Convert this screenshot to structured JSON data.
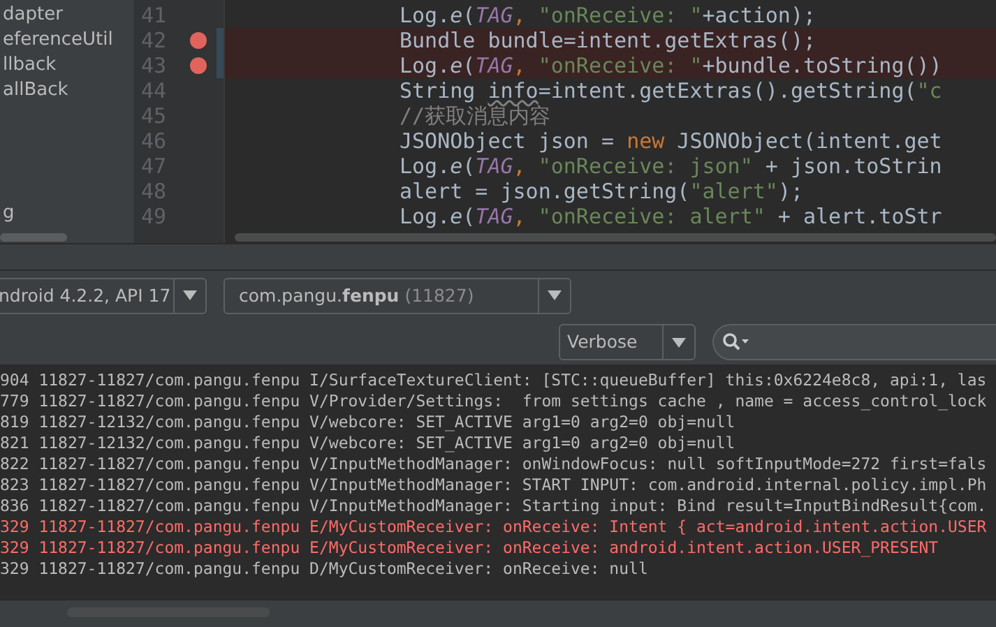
{
  "project_tree": {
    "items": [
      "dapter",
      "eferenceUtil",
      "llback",
      "allBack"
    ],
    "lower_items": [
      "g"
    ]
  },
  "editor": {
    "lines": [
      {
        "number": "41",
        "breakpoint": false,
        "tokens": [
          {
            "kind": "plain",
            "text": "Log."
          },
          {
            "kind": "italic",
            "text": "e"
          },
          {
            "kind": "plain",
            "text": "("
          },
          {
            "kind": "const",
            "text": "TAG"
          },
          {
            "kind": "punct",
            "text": ", "
          },
          {
            "kind": "string",
            "text": "\"onReceive: \""
          },
          {
            "kind": "plain",
            "text": "+action);"
          }
        ]
      },
      {
        "number": "42",
        "breakpoint": true,
        "tokens": [
          {
            "kind": "plain",
            "text": "Bundle bundle=intent.getExtras();"
          }
        ]
      },
      {
        "number": "43",
        "breakpoint": true,
        "tokens": [
          {
            "kind": "plain",
            "text": "Log."
          },
          {
            "kind": "italic",
            "text": "e"
          },
          {
            "kind": "plain",
            "text": "("
          },
          {
            "kind": "const",
            "text": "TAG"
          },
          {
            "kind": "punct",
            "text": ", "
          },
          {
            "kind": "string",
            "text": "\"onReceive: \""
          },
          {
            "kind": "plain",
            "text": "+bundle.toString())"
          }
        ]
      },
      {
        "number": "44",
        "breakpoint": false,
        "tokens": [
          {
            "kind": "plain",
            "text": "String "
          },
          {
            "kind": "warn",
            "text": "info"
          },
          {
            "kind": "plain",
            "text": "=intent.getExtras().getString("
          },
          {
            "kind": "string",
            "text": "\"c"
          }
        ]
      },
      {
        "number": "45",
        "breakpoint": false,
        "tokens": [
          {
            "kind": "comment",
            "text": "//获取消息内容"
          }
        ]
      },
      {
        "number": "46",
        "breakpoint": false,
        "tokens": [
          {
            "kind": "plain",
            "text": "JSONObject json = "
          },
          {
            "kind": "keyword",
            "text": "new"
          },
          {
            "kind": "plain",
            "text": " JSONObject(intent.get"
          }
        ]
      },
      {
        "number": "47",
        "breakpoint": false,
        "tokens": [
          {
            "kind": "plain",
            "text": "Log."
          },
          {
            "kind": "italic",
            "text": "e"
          },
          {
            "kind": "plain",
            "text": "("
          },
          {
            "kind": "const",
            "text": "TAG"
          },
          {
            "kind": "punct",
            "text": ", "
          },
          {
            "kind": "string",
            "text": "\"onReceive: json\""
          },
          {
            "kind": "plain",
            "text": " + json.toStrin"
          }
        ]
      },
      {
        "number": "48",
        "breakpoint": false,
        "tokens": [
          {
            "kind": "plain",
            "text": "alert = json.getString("
          },
          {
            "kind": "string",
            "text": "\"alert\""
          },
          {
            "kind": "plain",
            "text": ");"
          }
        ]
      },
      {
        "number": "49",
        "breakpoint": false,
        "tokens": [
          {
            "kind": "plain",
            "text": "Log."
          },
          {
            "kind": "italic",
            "text": "e"
          },
          {
            "kind": "plain",
            "text": "("
          },
          {
            "kind": "const",
            "text": "TAG"
          },
          {
            "kind": "punct",
            "text": ", "
          },
          {
            "kind": "string",
            "text": "\"onReceive: alert\""
          },
          {
            "kind": "plain",
            "text": " + alert.toStr"
          }
        ]
      }
    ]
  },
  "logcat": {
    "device": "ndroid 4.2.2, API 17",
    "process": {
      "package": "com.pangu.",
      "app": "fenpu",
      "pid": "(11827)"
    },
    "level_filter": "Verbose",
    "rows": [
      {
        "kind": "info",
        "text": "904 11827-11827/com.pangu.fenpu I/SurfaceTextureClient: [STC::queueBuffer] this:0x6224e8c8, api:1, las"
      },
      {
        "kind": "verbose",
        "text": "779 11827-11827/com.pangu.fenpu V/Provider/Settings:  from settings cache , name = access_control_lock"
      },
      {
        "kind": "verbose",
        "text": "819 11827-12132/com.pangu.fenpu V/webcore: SET_ACTIVE arg1=0 arg2=0 obj=null"
      },
      {
        "kind": "verbose",
        "text": "821 11827-12132/com.pangu.fenpu V/webcore: SET_ACTIVE arg1=0 arg2=0 obj=null"
      },
      {
        "kind": "verbose",
        "text": "822 11827-11827/com.pangu.fenpu V/InputMethodManager: onWindowFocus: null softInputMode=272 first=fals"
      },
      {
        "kind": "verbose",
        "text": "823 11827-11827/com.pangu.fenpu V/InputMethodManager: START INPUT: com.android.internal.policy.impl.Ph"
      },
      {
        "kind": "verbose",
        "text": "836 11827-11827/com.pangu.fenpu V/InputMethodManager: Starting input: Bind result=InputBindResult{com."
      },
      {
        "kind": "error",
        "text": "329 11827-11827/com.pangu.fenpu E/MyCustomReceiver: onReceive: Intent { act=android.intent.action.USER"
      },
      {
        "kind": "error",
        "text": "329 11827-11827/com.pangu.fenpu E/MyCustomReceiver: onReceive: android.intent.action.USER_PRESENT"
      },
      {
        "kind": "debug",
        "text": "329 11827-11827/com.pangu.fenpu D/MyCustomReceiver: onReceive: null"
      }
    ]
  }
}
